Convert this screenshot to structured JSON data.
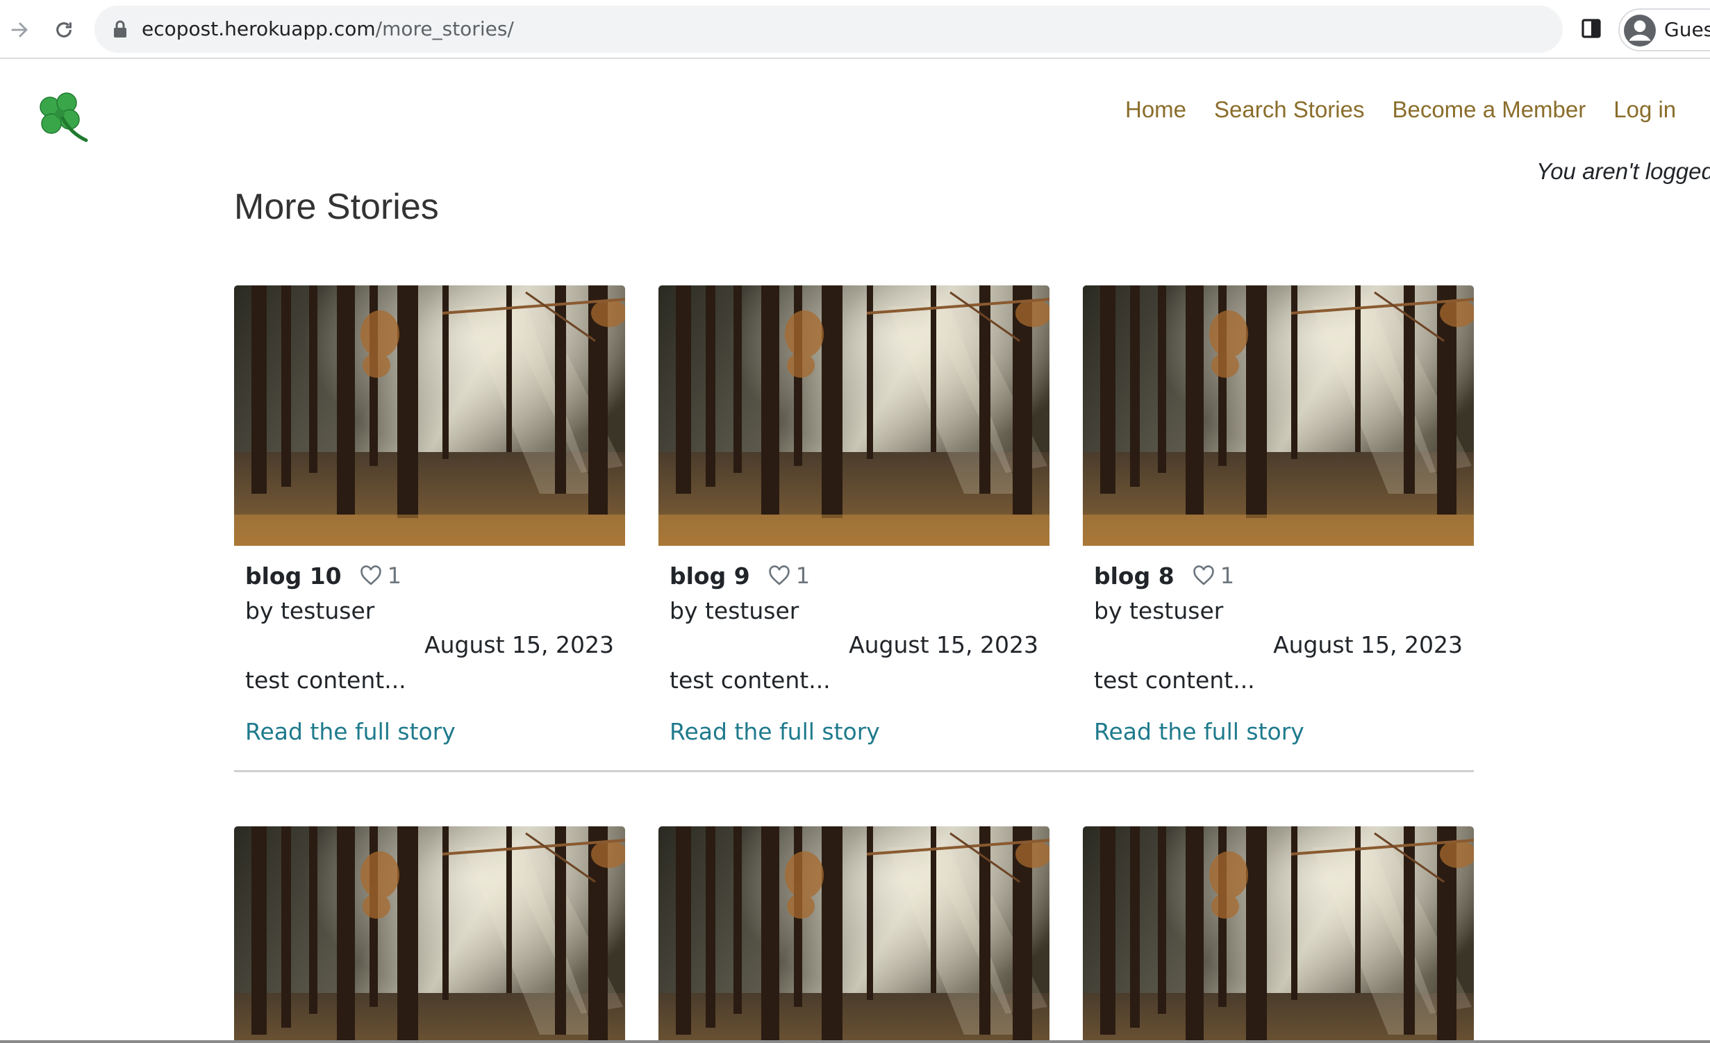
{
  "browser": {
    "url_host": "ecopost.herokuapp.com",
    "url_path": "/more_stories/",
    "profile_label": "Guest"
  },
  "site": {
    "nav": [
      "Home",
      "Search Stories",
      "Become a Member",
      "Log in"
    ],
    "login_status": "You aren't logged in",
    "page_title": "More Stories",
    "colors": {
      "nav_link": "#8a6d2b",
      "read_link": "#1e7a8c"
    }
  },
  "stories": [
    {
      "title": "blog 10",
      "likes": "1",
      "author": "by testuser",
      "date": "August 15, 2023",
      "excerpt": "test content...",
      "link": "Read the full story"
    },
    {
      "title": "blog 9",
      "likes": "1",
      "author": "by testuser",
      "date": "August 15, 2023",
      "excerpt": "test content...",
      "link": "Read the full story"
    },
    {
      "title": "blog 8",
      "likes": "1",
      "author": "by testuser",
      "date": "August 15, 2023",
      "excerpt": "test content...",
      "link": "Read the full story"
    }
  ]
}
